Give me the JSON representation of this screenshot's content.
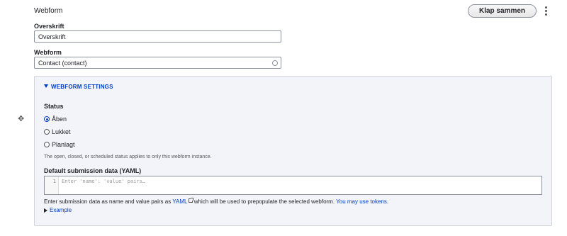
{
  "section": {
    "title": "Webform",
    "collapse_label": "Klap sammen"
  },
  "heading_field": {
    "label": "Overskrift",
    "value": "Overskrift"
  },
  "webform_field": {
    "label": "Webform",
    "value": "Contact (contact)"
  },
  "settings": {
    "summary_label": "WEBFORM SETTINGS",
    "status": {
      "label": "Status",
      "options": [
        {
          "label": "Åben",
          "checked": true
        },
        {
          "label": "Lukket",
          "checked": false
        },
        {
          "label": "Planlagt",
          "checked": false
        }
      ],
      "description": "The open, closed, or scheduled status applies to only this webform instance."
    },
    "default_data": {
      "label": "Default submission data (YAML)",
      "line_number": "1",
      "placeholder": "Enter 'name': 'value' pairs…",
      "help_prefix": "Enter submission data as name and value pairs as",
      "help_link": "YAML",
      "help_suffix": "which will be used to prepopulate the selected webform.",
      "tokens_link": "You may use tokens.",
      "example_label": "Example"
    }
  },
  "icons": {
    "drag": "drag-handle-icon",
    "kebab": "more-actions-icon",
    "autocomplete": "autocomplete-icon",
    "external": "external-link-icon"
  },
  "colors": {
    "link": "#003ecc",
    "details_bg": "#f3f4f9",
    "border": "#8e929c"
  }
}
